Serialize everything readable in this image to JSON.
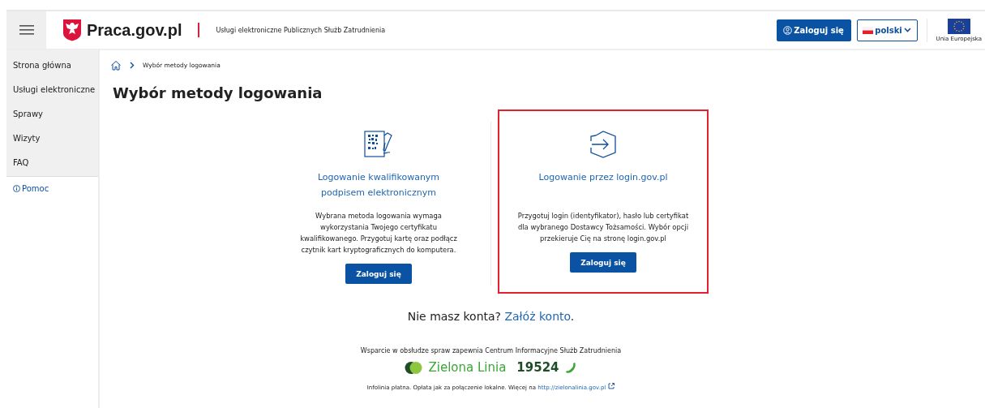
{
  "header": {
    "logo": "Praca.gov.pl",
    "subtitle": "Usługi elektroniczne Publicznych Służb Zatrudnienia",
    "login_button": "Zaloguj się",
    "language": "polski",
    "eu_label": "Unia Europejska"
  },
  "sidebar": {
    "items": [
      {
        "label": "Strona główna"
      },
      {
        "label": "Usługi elektroniczne"
      },
      {
        "label": "Sprawy"
      },
      {
        "label": "Wizyty"
      },
      {
        "label": "FAQ"
      }
    ],
    "help": "Pomoc"
  },
  "breadcrumb": [
    "Wybór metody logowania"
  ],
  "title": "Wybór metody logowania",
  "methods": [
    {
      "kind": "signature",
      "title": "Logowanie kwalifikowanym podpisem elektronicznym",
      "description": "Wybrana metoda logowania wymaga wykorzystania Twojego certyfikatu kwalifikowanego. Przygotuj kartę oraz podłącz czytnik kart kryptograficznych do komputera.",
      "button": "Zaloguj się",
      "highlighted": false
    },
    {
      "kind": "login",
      "title": "Logowanie przez login.gov.pl",
      "description": "Przygotuj login (identyfikator), hasło lub certyfikat dla wybranego Dostawcy Tożsamości. Wybór opcji przekieruje Cię na stronę login.gov.pl",
      "button": "Zaloguj się",
      "highlighted": true
    }
  ],
  "no_account": {
    "text": "Nie masz konta?",
    "link": "Załóż konto",
    "end": "."
  },
  "support": {
    "text": "Wsparcie w obsłudze spraw zapewnia Centrum Informacyjne Służb Zatrudnienia",
    "line_name": "Zielona Linia",
    "phone": "19524",
    "note": "Infolinia płatna. Opłata jak za połączenie lokalne. Więcej na",
    "note_link": "http://zielonalinia.gov.pl"
  }
}
